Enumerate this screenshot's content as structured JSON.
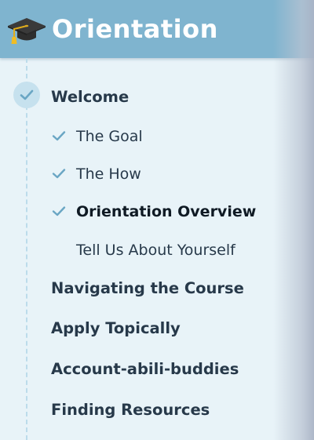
{
  "header": {
    "title": "Orientation",
    "icon": "graduation-cap-icon",
    "background": "#7fb4cf"
  },
  "sections": [
    {
      "title": "Welcome",
      "completed": true,
      "lessons": [
        {
          "label": "The Goal",
          "completed": true,
          "active": false
        },
        {
          "label": "The How",
          "completed": true,
          "active": false
        },
        {
          "label": "Orientation Overview",
          "completed": true,
          "active": true
        },
        {
          "label": "Tell Us About Yourself",
          "completed": false,
          "active": false
        }
      ]
    },
    {
      "title": "Navigating the Course"
    },
    {
      "title": "Apply Topically"
    },
    {
      "title": "Account-abili-buddies"
    },
    {
      "title": "Finding Resources"
    }
  ],
  "colors": {
    "check": "#6aa6c4",
    "marker": "#c6e1ee",
    "text": "#27394a",
    "panel": "#e8f3f8"
  }
}
